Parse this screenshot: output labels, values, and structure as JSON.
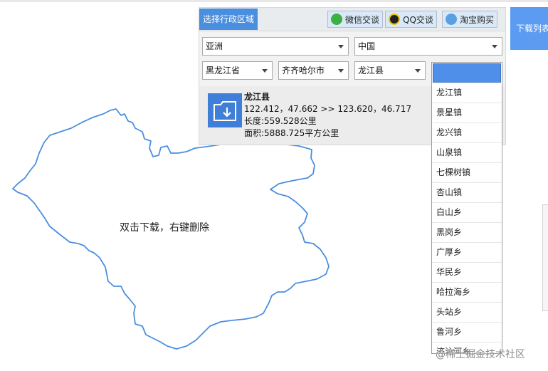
{
  "panel": {
    "title_tab": "选择行政区域",
    "buttons": {
      "wechat": "微信交谈",
      "qq": "QQ交谈",
      "taobao": "淘宝购买"
    }
  },
  "selects": {
    "continent": "亚洲",
    "country": "中国",
    "province": "黑龙江省",
    "city": "齐齐哈尔市",
    "county": "龙江县"
  },
  "info": {
    "name": "龙江县",
    "bbox_text": "122.412，47.662 >> 123.620，46.717",
    "length_text": "长度:559.528公里",
    "area_text": "面积:5888.725平方公里"
  },
  "town_dropdown": {
    "options": [
      "龙江镇",
      "景星镇",
      "龙兴镇",
      "山泉镇",
      "七棵树镇",
      "杏山镇",
      "白山乡",
      "黑岗乡",
      "广厚乡",
      "华民乡",
      "哈拉海乡",
      "头站乡",
      "鲁河乡",
      "济沁河乡"
    ]
  },
  "map": {
    "hint": "双击下载，右键删除",
    "outline_color": "#4a8ee0"
  },
  "side": {
    "download_list": "下载列表"
  },
  "watermark": "@稀土掘金技术社区"
}
